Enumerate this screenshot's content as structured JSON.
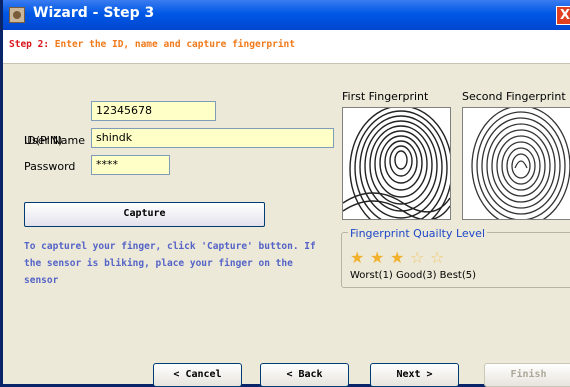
{
  "window": {
    "title": "Wizard - Step 3",
    "close_glyph": "X"
  },
  "header": {
    "step_number": "Step 2:",
    "step_description": "Enter the ID, name and capture fingerprint"
  },
  "form": {
    "id_label": "ID(PIN)",
    "id_value": "12345678",
    "username_label": "User Name",
    "username_value": "shindk",
    "password_label": "Password",
    "password_value": "****"
  },
  "capture": {
    "button_label": "Capture",
    "instructions": "To capturel your finger, click 'Capture' button. If the sensor is bliking, place your finger on the sensor"
  },
  "fingerprints": {
    "first_label": "First Fingerprint",
    "second_label": "Second Fingerprint"
  },
  "quality": {
    "title": "Fingerprint Quailty Level",
    "stars_filled": 3,
    "stars_total": 5,
    "scale_text": "Worst(1) Good(3) Best(5)",
    "star_color": "#f2b12c"
  },
  "buttons": {
    "cancel": "< Cancel",
    "back": "< Back",
    "next": "Next >",
    "finish": "Finish"
  }
}
